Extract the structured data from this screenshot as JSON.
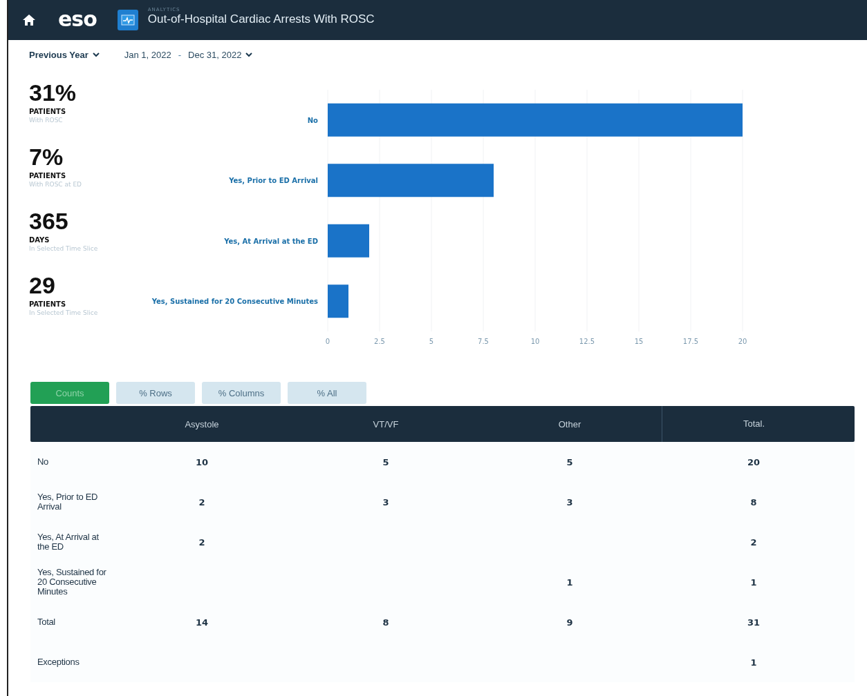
{
  "header": {
    "logo": "eso",
    "section": "ANALYTICS",
    "title": "Out-of-Hospital Cardiac Arrests With ROSC"
  },
  "filters": {
    "period": "Previous Year",
    "start": "Jan 1, 2022",
    "separator": "-",
    "end": "Dec 31, 2022"
  },
  "stats": [
    {
      "value": "31%",
      "unit": "PATIENTS",
      "caption": "With ROSC"
    },
    {
      "value": "7%",
      "unit": "PATIENTS",
      "caption": "With ROSC at ED"
    },
    {
      "value": "365",
      "unit": "DAYS",
      "caption": "In Selected Time Slice"
    },
    {
      "value": "29",
      "unit": "PATIENTS",
      "caption": "In Selected Time Slice"
    }
  ],
  "chart_data": {
    "type": "bar",
    "orientation": "horizontal",
    "categories": [
      "No",
      "Yes, Prior to ED Arrival",
      "Yes, At Arrival at the ED",
      "Yes, Sustained for 20 Consecutive Minutes"
    ],
    "series": [
      {
        "color": "#1a73c8",
        "values": [
          20,
          8,
          2,
          1
        ]
      }
    ],
    "xlim": [
      0,
      20
    ],
    "grid": true,
    "xticks": [
      0,
      2.5,
      5,
      7.5,
      10,
      12.5,
      15,
      17.5,
      20
    ]
  },
  "view_tabs": [
    {
      "label": "Counts",
      "selected": true
    },
    {
      "label": "% Rows",
      "selected": false
    },
    {
      "label": "% Columns",
      "selected": false
    },
    {
      "label": "% All",
      "selected": false
    }
  ],
  "table": {
    "columns": [
      "Asystole",
      "VT/VF",
      "Other",
      "Total."
    ],
    "rows": [
      {
        "label": "No",
        "cells": [
          "10",
          "5",
          "5",
          "20"
        ]
      },
      {
        "label": "Yes, Prior to ED Arrival",
        "cells": [
          "2",
          "3",
          "3",
          "8"
        ]
      },
      {
        "label": "Yes, At Arrival at the ED",
        "cells": [
          "2",
          null,
          null,
          "2"
        ]
      },
      {
        "label": "Yes, Sustained for 20 Consecutive Minutes",
        "cells": [
          null,
          null,
          "1",
          "1"
        ]
      },
      {
        "label": "Total",
        "cells": [
          "14",
          "8",
          "9",
          "31"
        ]
      },
      {
        "label": "Exceptions",
        "cells": [
          null,
          null,
          null,
          "1"
        ]
      }
    ]
  }
}
